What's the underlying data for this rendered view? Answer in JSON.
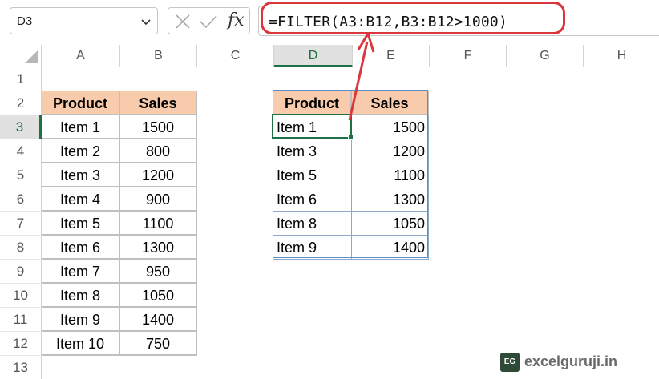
{
  "name_box": {
    "value": "D3"
  },
  "formula_bar": {
    "fx_label": "fx",
    "formula": "=FILTER(A3:B12,B3:B12>1000)"
  },
  "columns": [
    "A",
    "B",
    "C",
    "D",
    "E",
    "F",
    "G",
    "H"
  ],
  "active_column": "D",
  "rows": [
    "1",
    "2",
    "3",
    "4",
    "5",
    "6",
    "7",
    "8",
    "9",
    "10",
    "11",
    "12",
    "13"
  ],
  "active_row": "3",
  "source_table": {
    "headers": [
      "Product",
      "Sales"
    ],
    "rows": [
      [
        "Item 1",
        "1500"
      ],
      [
        "Item 2",
        "800"
      ],
      [
        "Item 3",
        "1200"
      ],
      [
        "Item 4",
        "900"
      ],
      [
        "Item 5",
        "1100"
      ],
      [
        "Item 6",
        "1300"
      ],
      [
        "Item 7",
        "950"
      ],
      [
        "Item 8",
        "1050"
      ],
      [
        "Item 9",
        "1400"
      ],
      [
        "Item 10",
        "750"
      ]
    ]
  },
  "result_table": {
    "headers": [
      "Product",
      "Sales"
    ],
    "rows": [
      [
        "Item 1",
        "1500"
      ],
      [
        "Item 3",
        "1200"
      ],
      [
        "Item 5",
        "1100"
      ],
      [
        "Item 6",
        "1300"
      ],
      [
        "Item 8",
        "1050"
      ],
      [
        "Item 9",
        "1400"
      ]
    ]
  },
  "colors": {
    "header_fill": "#f8cbad",
    "selection": "#1e7145",
    "annotation": "#d9363e",
    "result_border": "#5b8cc7"
  },
  "watermark": {
    "logo": "EG",
    "text": "excelguruji.in"
  }
}
